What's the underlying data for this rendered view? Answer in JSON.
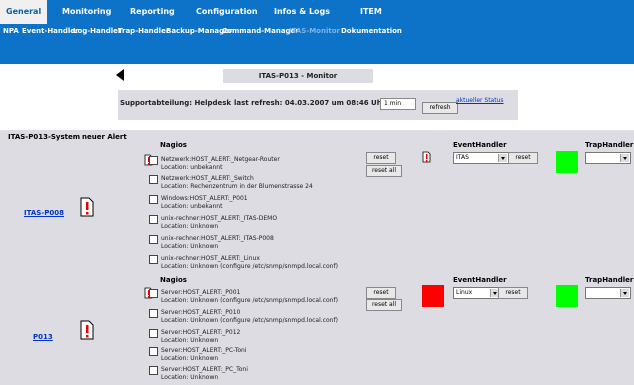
{
  "nav": {
    "primary": [
      "General",
      "Monitoring",
      "Reporting",
      "Configuration",
      "Infos & Logs",
      "ITEM"
    ],
    "secondary": [
      "NPA",
      "Event-Handler",
      "Log-Handler",
      "Trap-Handler",
      "Backup-Manager",
      "Command-Manager",
      "ITAS-Monitor",
      "Dokumentation"
    ]
  },
  "page": {
    "title": "ITAS-P013 - Monitor",
    "support_dept": "Supportabteilung: Helpdesk",
    "last_refresh": "last refresh: 04.03.2007 um 08:46 Uhr",
    "interval_value": "1 min",
    "refresh_label": "refresh",
    "status_link": "aktueller Status"
  },
  "panel": {
    "system_label": "ITAS-P013-System",
    "new_alert_label": "neuer Alert",
    "nagios_label": "Nagios",
    "eventhandler_label": "EventHandler",
    "traphandler_label": "TrapHandler",
    "reset_label": "reset",
    "reset_all_label": "reset all"
  },
  "hosts": [
    {
      "name": "ITAS-P008",
      "event_select": "ITAS",
      "status_color": "#00ff00",
      "trap_status_color": "#00ff00",
      "alerts": [
        {
          "line1": "Netzwerk:HOST_ALERT:_Netgear-Router",
          "line2": "Location: unbekannt"
        },
        {
          "line1": "Netzwerk:HOST_ALERT:_Switch",
          "line2": "Location: Rechenzentrum in der Blumenstrasse 24"
        },
        {
          "line1": "Windows:HOST_ALERT:_P001",
          "line2": "Location: unbekannt"
        },
        {
          "line1": "unix-rechner:HOST_ALERT:_ITAS-DEMO",
          "line2": "Location: Unknown"
        },
        {
          "line1": "unix-rechner:HOST_ALERT:_ITAS-P008",
          "line2": "Location: Unknown"
        },
        {
          "line1": "unix-rechner:HOST_ALERT:_Linux",
          "line2": "Location: Unknown (configure /etc/snmp/snmpd.local.conf)"
        }
      ]
    },
    {
      "name": "P013",
      "event_select": "Linux",
      "status_color": "#ff0000",
      "trap_status_color": "#00ff00",
      "alerts": [
        {
          "line1": "Server:HOST_ALERT:_P001",
          "line2": "Location: Unknown (configure /etc/snmp/snmpd.local.conf)"
        },
        {
          "line1": "Server:HOST_ALERT:_P010",
          "line2": "Location: Unknown (configure /etc/snmp/snmpd.local.conf)"
        },
        {
          "line1": "Server:HOST_ALERT:_P012",
          "line2": "Location: Unknown"
        },
        {
          "line1": "Server:HOST_ALERT:_PC-Toni",
          "line2": "Location: Unknown"
        },
        {
          "line1": "Server:HOST_ALERT:_PC_Toni",
          "line2": "Location: Unknown"
        }
      ]
    }
  ],
  "colors": {
    "header_blue": "#0c73c9",
    "panel_gray": "#dcdce2",
    "link_blue": "#0033cc"
  },
  "icons": [
    "back-arrow-icon",
    "alert-document-icon",
    "small-alert-document-icon",
    "dropdown-arrow-icon"
  ]
}
